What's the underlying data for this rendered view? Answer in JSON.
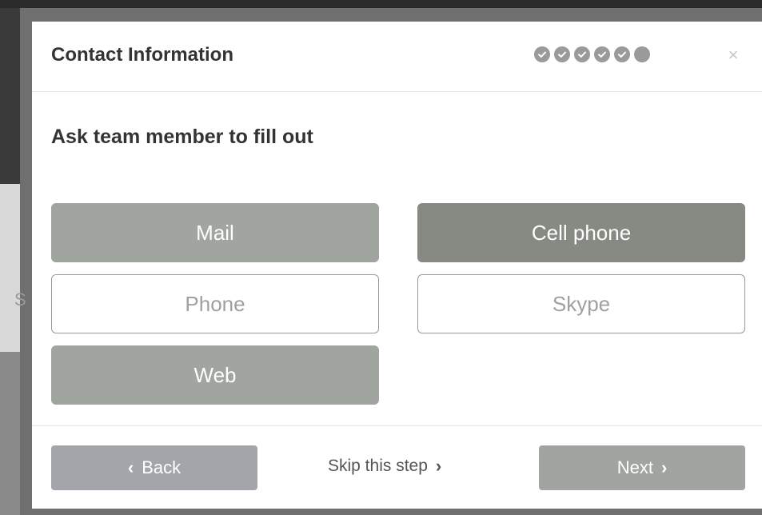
{
  "modal": {
    "title": "Contact Information",
    "close_icon": "×",
    "progress": {
      "total_steps": 6,
      "completed_steps": 5,
      "step_icon": "check-icon"
    },
    "subtitle": "Ask team member to fill out"
  },
  "options": [
    {
      "label": "Mail",
      "state": "selected"
    },
    {
      "label": "Cell phone",
      "state": "selected-active"
    },
    {
      "label": "Phone",
      "state": "unselected"
    },
    {
      "label": "Skype",
      "state": "unselected"
    },
    {
      "label": "Web",
      "state": "selected"
    }
  ],
  "footer": {
    "back_label": "Back",
    "back_icon": "‹",
    "skip_label": "Skip this step",
    "skip_icon": "›",
    "next_label": "Next",
    "next_icon": "›"
  },
  "background": {
    "peek_text": "Sk"
  },
  "colors": {
    "option_selected": "#a0a59f",
    "option_active": "#868a83",
    "back_button": "#a2a6aa",
    "progress_dot": "#9a9a9a"
  }
}
